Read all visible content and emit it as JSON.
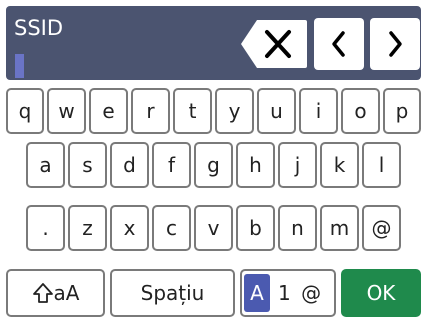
{
  "header": {
    "field_label": "SSID"
  },
  "controls": {
    "backspace_icon": "backspace-icon",
    "left_icon": "chevron-left-icon",
    "right_icon": "chevron-right-icon"
  },
  "keyboard": {
    "row1": [
      "q",
      "w",
      "e",
      "r",
      "t",
      "y",
      "u",
      "i",
      "o",
      "p"
    ],
    "row2": [
      "a",
      "s",
      "d",
      "f",
      "g",
      "h",
      "j",
      "k",
      "l"
    ],
    "row3": [
      ".",
      "z",
      "x",
      "c",
      "v",
      "b",
      "n",
      "m",
      "@"
    ],
    "shift_label": "aA",
    "shift_icon": "shift-arrow-icon",
    "space_label": "Spațiu",
    "mode_selected": "A",
    "mode_rest": "1 @",
    "ok_label": "OK"
  },
  "colors": {
    "header_bg": "#4b5470",
    "cursor": "#6a74c6",
    "ok_bg": "#1f8a4c",
    "mode_selected_bg": "#4b5ab0"
  }
}
